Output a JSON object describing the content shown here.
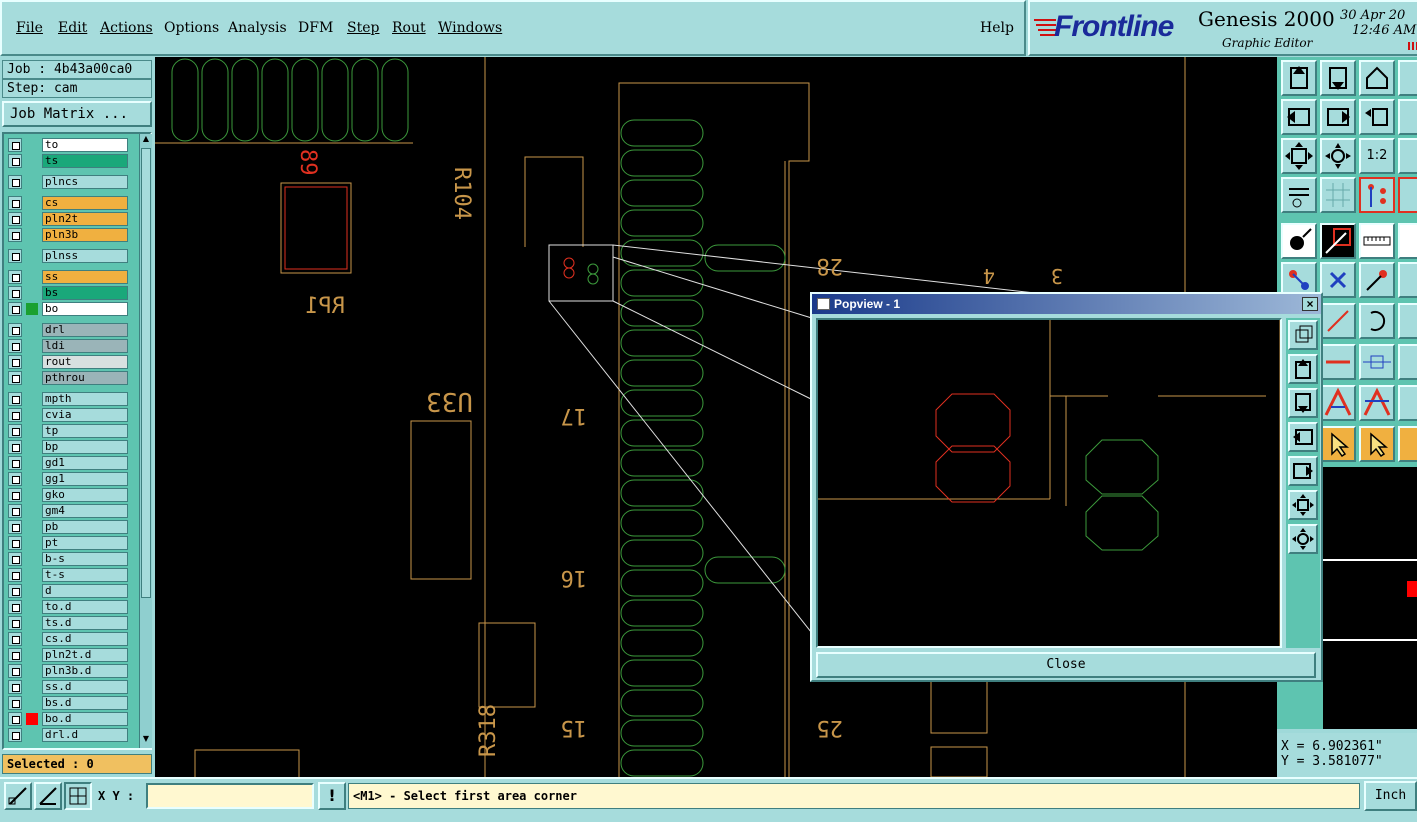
{
  "menu": {
    "file": "File",
    "edit": "Edit",
    "actions": "Actions",
    "options": "Options",
    "analysis": "Analysis",
    "dfm": "DFM",
    "step": "Step",
    "rout": "Rout",
    "windows": "Windows",
    "help": "Help"
  },
  "brand": {
    "logo": "Frontline",
    "product": "Genesis 2000",
    "subtitle": "Graphic Editor",
    "date": "30 Apr 20",
    "time": "12:46 AM"
  },
  "job": {
    "job_label": "Job : 4b43a00ca0",
    "step_label": "Step: cam",
    "matrix_button": "Job Matrix ...",
    "selected": "Selected : 0"
  },
  "layers": [
    {
      "name": "to",
      "color": "#000000",
      "bg": "#ffffff"
    },
    {
      "name": "ts",
      "color": "#000000",
      "bg": "#1aa87a"
    },
    {
      "name": "plncs",
      "color": "#000000",
      "bg": "#a6dcdc"
    },
    {
      "name": "cs",
      "color": "#000000",
      "bg": "#f0b040"
    },
    {
      "name": "pln2t",
      "color": "#000000",
      "bg": "#f0b040"
    },
    {
      "name": "pln3b",
      "color": "#000000",
      "bg": "#f0b040"
    },
    {
      "name": "plnss",
      "color": "#000000",
      "bg": "#a6dcdc"
    },
    {
      "name": "ss",
      "color": "#000000",
      "bg": "#f0b040"
    },
    {
      "name": "bs",
      "color": "#000000",
      "bg": "#1aa87a"
    },
    {
      "name": "bo",
      "color": "#1aa030",
      "bg": "#ffffff"
    },
    {
      "name": "drl",
      "color": "#000000",
      "bg": "#9ab4b8"
    },
    {
      "name": "ldi",
      "color": "#000000",
      "bg": "#9ab4b8"
    },
    {
      "name": "rout",
      "color": "#000000",
      "bg": "#d8e0e0"
    },
    {
      "name": "pthrou",
      "color": "#000000",
      "bg": "#9ab4b8"
    },
    {
      "name": "mpth",
      "color": "#000000",
      "bg": "#a6dcdc"
    },
    {
      "name": "cvia",
      "color": "#000000",
      "bg": "#a6dcdc"
    },
    {
      "name": "tp",
      "color": "#000000",
      "bg": "#a6dcdc"
    },
    {
      "name": "bp",
      "color": "#000000",
      "bg": "#a6dcdc"
    },
    {
      "name": "gd1",
      "color": "#000000",
      "bg": "#a6dcdc"
    },
    {
      "name": "gg1",
      "color": "#000000",
      "bg": "#a6dcdc"
    },
    {
      "name": "gko",
      "color": "#000000",
      "bg": "#a6dcdc"
    },
    {
      "name": "gm4",
      "color": "#000000",
      "bg": "#a6dcdc"
    },
    {
      "name": "pb",
      "color": "#000000",
      "bg": "#a6dcdc"
    },
    {
      "name": "pt",
      "color": "#000000",
      "bg": "#a6dcdc"
    },
    {
      "name": "b-s",
      "color": "#000000",
      "bg": "#a6dcdc"
    },
    {
      "name": "t-s",
      "color": "#000000",
      "bg": "#a6dcdc"
    },
    {
      "name": "d",
      "color": "#000000",
      "bg": "#a6dcdc"
    },
    {
      "name": "to.d",
      "color": "#000000",
      "bg": "#a6dcdc"
    },
    {
      "name": "ts.d",
      "color": "#000000",
      "bg": "#a6dcdc"
    },
    {
      "name": "cs.d",
      "color": "#000000",
      "bg": "#a6dcdc"
    },
    {
      "name": "pln2t.d",
      "color": "#000000",
      "bg": "#a6dcdc"
    },
    {
      "name": "pln3b.d",
      "color": "#000000",
      "bg": "#a6dcdc"
    },
    {
      "name": "ss.d",
      "color": "#000000",
      "bg": "#a6dcdc"
    },
    {
      "name": "bs.d",
      "color": "#000000",
      "bg": "#a6dcdc"
    },
    {
      "name": "bo.d",
      "color": "#ff0000",
      "bg": "#a6dcdc"
    },
    {
      "name": "drl.d",
      "color": "#000000",
      "bg": "#a6dcdc"
    }
  ],
  "canvas_labels": {
    "rp1": "RP1",
    "u33": "U33",
    "r104": "R104",
    "r318": "R318",
    "n89": "89",
    "n28": "28",
    "n17": "17",
    "n16": "16",
    "n15": "15",
    "n25": "25",
    "n4": "4",
    "n3": "3",
    "n8a": "8",
    "n8b": "8"
  },
  "popview": {
    "title": "Popview - 1",
    "close": "Close"
  },
  "coords": {
    "x": "X = 6.902361\"",
    "y": "Y = 3.581077\""
  },
  "bottom": {
    "xy_label": "X Y :",
    "xy_value": "",
    "prompt": "<M1> - Select first area corner",
    "unit": "Inch"
  },
  "colors": {
    "panel": "#a6dcdc",
    "accent_green": "#5ec4b0",
    "pcb_orange": "#c8964a",
    "pcb_green": "#3c9a3c",
    "pcb_red": "#e03020"
  }
}
